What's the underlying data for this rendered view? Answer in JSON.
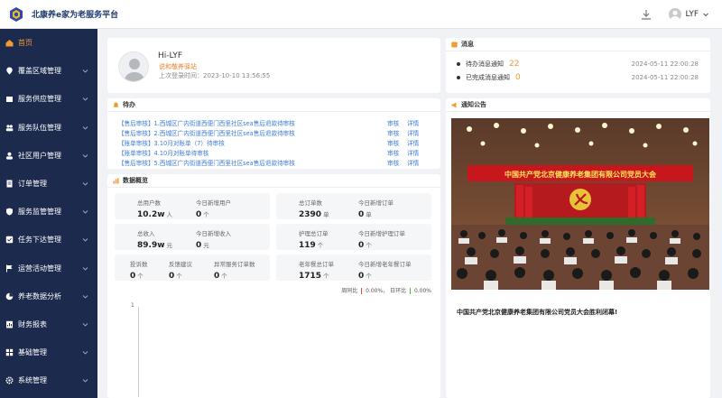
{
  "app": {
    "title": "北康养e家为老服务平台"
  },
  "header": {
    "user": "LYF"
  },
  "sidebar": {
    "items": [
      {
        "label": "首页"
      },
      {
        "label": "覆盖区域管理"
      },
      {
        "label": "服务供应管理"
      },
      {
        "label": "服务队伍管理"
      },
      {
        "label": "社区用户管理"
      },
      {
        "label": "订单管理"
      },
      {
        "label": "服务监管管理"
      },
      {
        "label": "任务下达管理"
      },
      {
        "label": "运营活动管理"
      },
      {
        "label": "养老数据分析"
      },
      {
        "label": "财务报表"
      },
      {
        "label": "基础管理"
      },
      {
        "label": "系统管理"
      }
    ]
  },
  "profile": {
    "greeting": "Hi-LYF",
    "station": "说和敬养驿站",
    "last_login": "上次登录时间：2023-10-10 13:56:55"
  },
  "messages": {
    "title": "消息",
    "items": [
      {
        "label": "待办消息通知",
        "count": "22",
        "time": "2024-05-11 22:00:28"
      },
      {
        "label": "已完成消息通知",
        "count": "0",
        "time": "2024-05-11 22:00:28"
      }
    ]
  },
  "todo": {
    "title": "待办",
    "items": [
      {
        "text": "【售后审核】1.西城区广内街道西便门西里社区sea售后退款待审核",
        "audit": "审核",
        "detail": "详情"
      },
      {
        "text": "【售后审核】2.西城区广内街道西便门西里社区sea售后退款待审核",
        "audit": "审核",
        "detail": "详情"
      },
      {
        "text": "【账单审核】3.10月对账单（7）待审核",
        "audit": "审核",
        "detail": "详情"
      },
      {
        "text": "【账单审核】4.10月对账单待审核",
        "audit": "审核",
        "detail": "详情"
      },
      {
        "text": "【售后审核】5.西城区广内街道西便门西里社区sea售后退款待审核",
        "audit": "审核",
        "detail": "详情"
      }
    ]
  },
  "overview": {
    "title": "数据概览",
    "stats": {
      "total_users": {
        "label": "总用户数",
        "value": "10.2w",
        "unit": "人"
      },
      "new_users": {
        "label": "今日新增用户",
        "value": "0",
        "unit": "个"
      },
      "total_income": {
        "label": "总收入",
        "value": "89.9w",
        "unit": "元"
      },
      "new_income": {
        "label": "今日新增收入",
        "value": "0",
        "unit": "元"
      },
      "complaints": {
        "label": "投诉数",
        "value": "0",
        "unit": "个"
      },
      "feedback": {
        "label": "反馈建议",
        "value": "0",
        "unit": "个"
      },
      "abnormal": {
        "label": "异常服务订单数",
        "value": "0",
        "unit": "个"
      },
      "total_orders": {
        "label": "总订单数",
        "value": "2390",
        "unit": "单"
      },
      "new_orders": {
        "label": "今日新增订单",
        "value": "0",
        "unit": "单"
      },
      "care_orders": {
        "label": "护理总订单",
        "value": "119",
        "unit": "个"
      },
      "new_care_orders": {
        "label": "今日新增护理订单",
        "value": "0",
        "unit": "个"
      },
      "meal_orders": {
        "label": "老年餐总订单",
        "value": "1715",
        "unit": "个"
      },
      "new_meal_orders": {
        "label": "今日新增老年餐订单",
        "value": "0",
        "unit": "个"
      }
    },
    "ratio_wow_label": "周同比",
    "ratio_wow": "0.00%",
    "ratio_dod_label": "日环比",
    "ratio_dod": "0.00%",
    "chart_tick": "1"
  },
  "notice": {
    "title": "通知公告",
    "banner_text": "中国共产党北京健康养老集团有限公司党员大会",
    "caption": "中国共产党北京健康养老集团有限公司党员大会胜利闭幕!"
  },
  "colors": {
    "sidebar": "#1c2a4d",
    "accent": "#f29a2e",
    "link": "#3d7bd8"
  }
}
